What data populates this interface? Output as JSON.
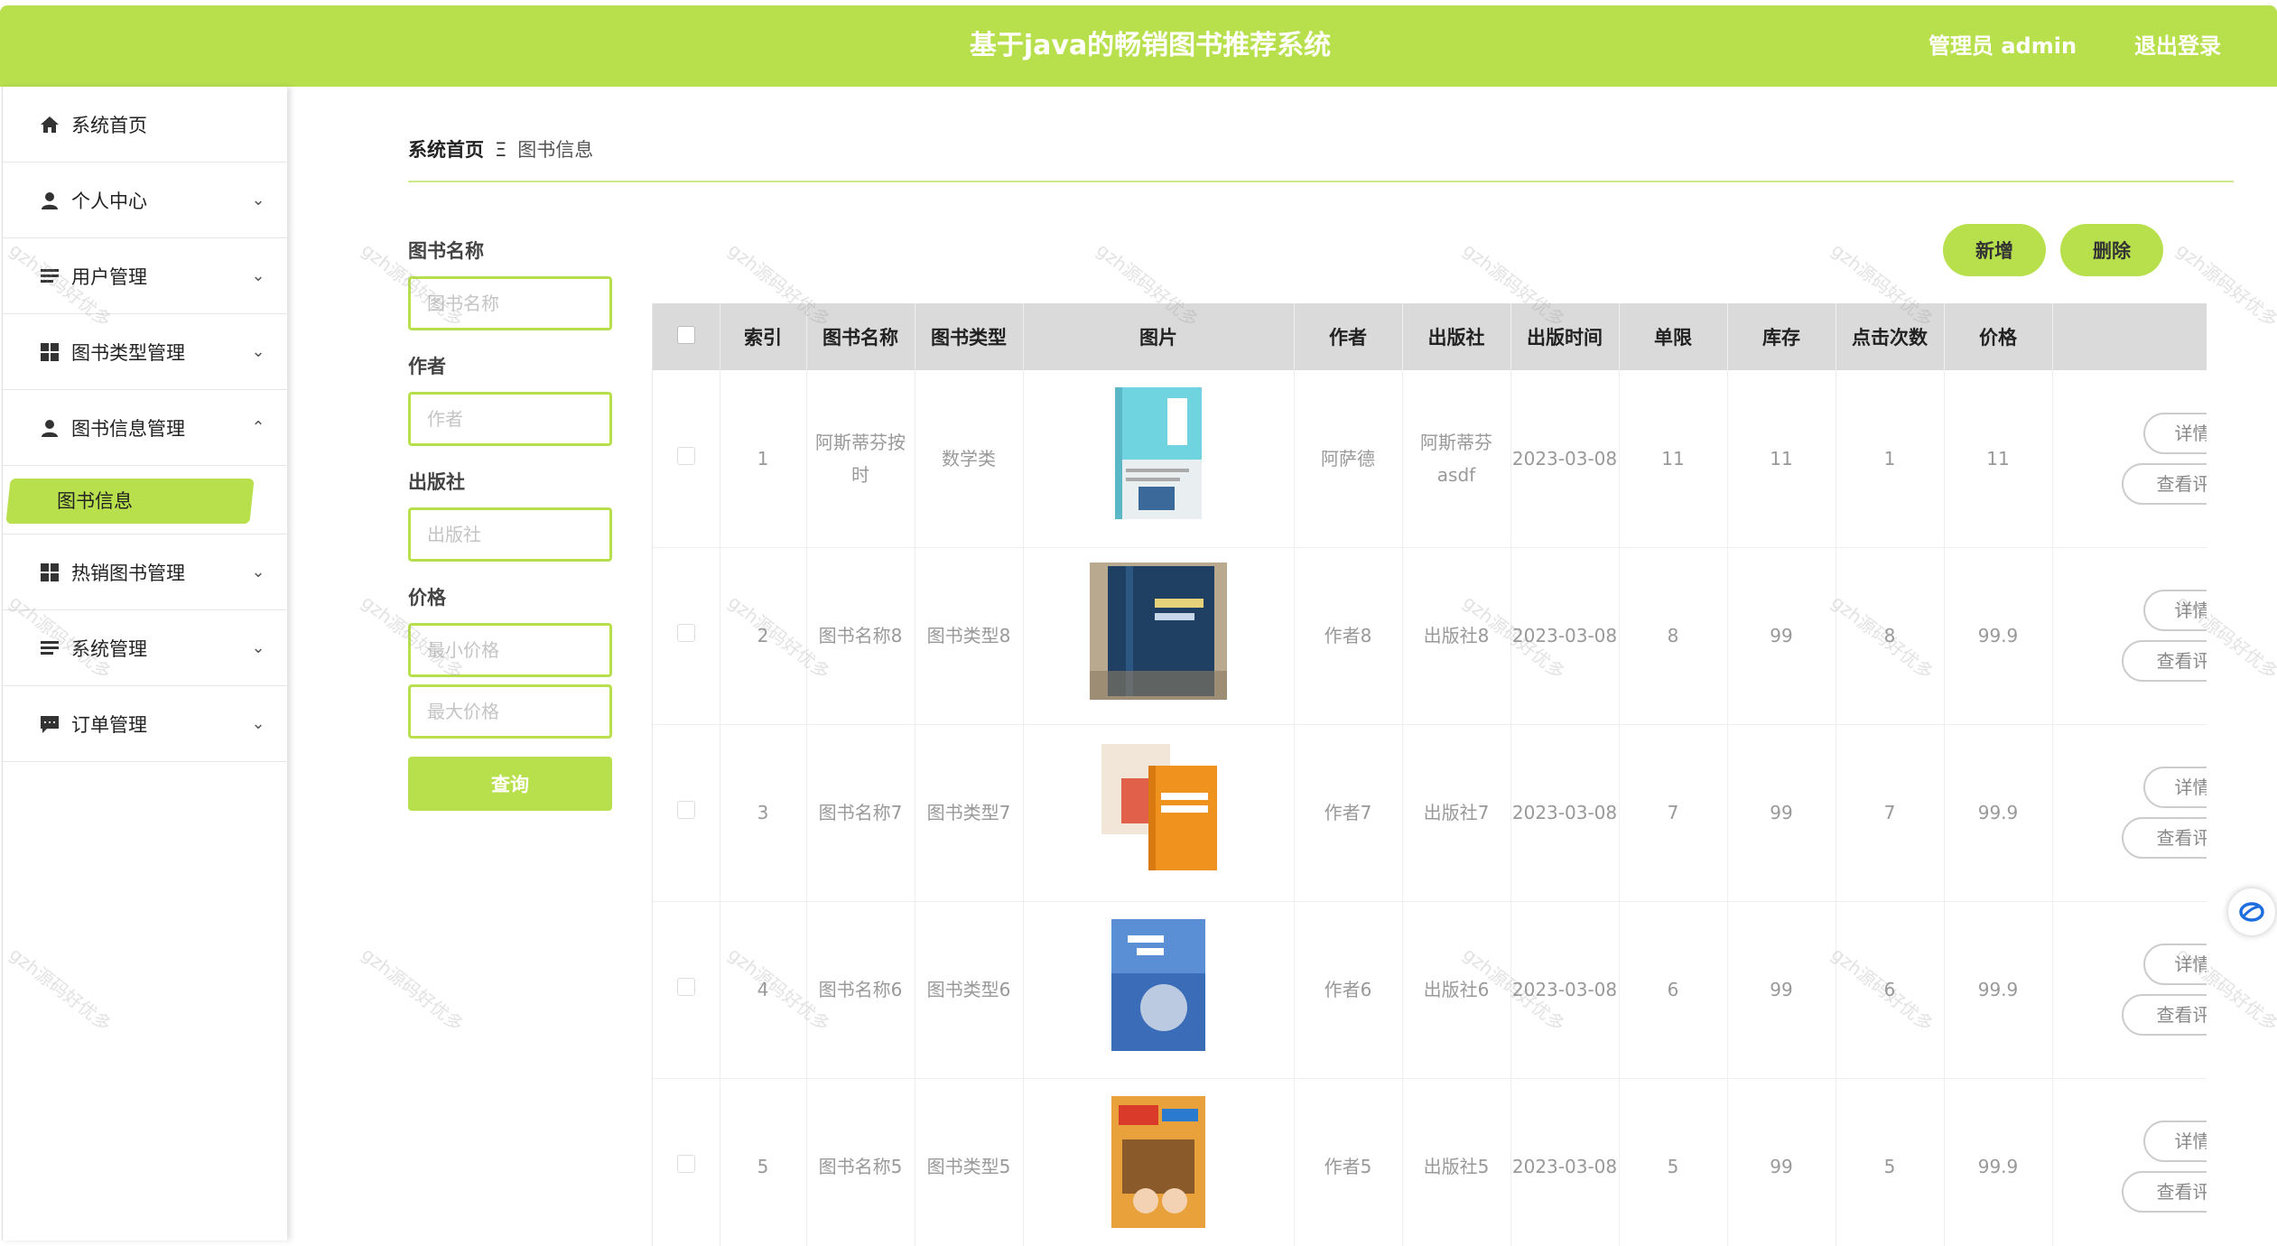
{
  "header": {
    "title": "基于java的畅销图书推荐系统",
    "admin_label": "管理员 admin",
    "logout_label": "退出登录"
  },
  "sidebar": {
    "items": [
      {
        "label": "系统首页",
        "icon": "home-icon"
      },
      {
        "label": "个人中心",
        "icon": "user-icon"
      },
      {
        "label": "用户管理",
        "icon": "list-icon"
      },
      {
        "label": "图书类型管理",
        "icon": "grid-icon"
      },
      {
        "label": "图书信息管理",
        "icon": "user-icon"
      },
      {
        "label": "图书信息",
        "icon": ""
      },
      {
        "label": "热销图书管理",
        "icon": "grid-icon"
      },
      {
        "label": "系统管理",
        "icon": "list-icon"
      },
      {
        "label": "订单管理",
        "icon": "chat-icon"
      }
    ]
  },
  "breadcrumb": {
    "home": "系统首页",
    "separator": "Ξ",
    "current": "图书信息"
  },
  "filters": {
    "name_label": "图书名称",
    "name_placeholder": "图书名称",
    "author_label": "作者",
    "author_placeholder": "作者",
    "publisher_label": "出版社",
    "publisher_placeholder": "出版社",
    "price_label": "价格",
    "min_price_placeholder": "最小价格",
    "max_price_placeholder": "最大价格",
    "search_label": "查询"
  },
  "actions": {
    "add_label": "新增",
    "delete_label": "删除"
  },
  "table": {
    "headers": [
      "索引",
      "图书名称",
      "图书类型",
      "图片",
      "作者",
      "出版社",
      "出版时间",
      "单限",
      "库存",
      "点击次数",
      "价格"
    ],
    "detail_label": "详情",
    "review_label": "查看评论",
    "rows": [
      {
        "index": "1",
        "name": "阿斯蒂芬按时",
        "type": "数学类",
        "author": "阿萨德",
        "publisher": "阿斯蒂芬asdf",
        "date": "2023-03-08",
        "limit": "11",
        "stock": "11",
        "clicks": "1",
        "price": "11",
        "cover": "book-cover-1"
      },
      {
        "index": "2",
        "name": "图书名称8",
        "type": "图书类型8",
        "author": "作者8",
        "publisher": "出版社8",
        "date": "2023-03-08",
        "limit": "8",
        "stock": "99",
        "clicks": "8",
        "price": "99.9",
        "cover": "book-cover-2"
      },
      {
        "index": "3",
        "name": "图书名称7",
        "type": "图书类型7",
        "author": "作者7",
        "publisher": "出版社7",
        "date": "2023-03-08",
        "limit": "7",
        "stock": "99",
        "clicks": "7",
        "price": "99.9",
        "cover": "book-cover-3"
      },
      {
        "index": "4",
        "name": "图书名称6",
        "type": "图书类型6",
        "author": "作者6",
        "publisher": "出版社6",
        "date": "2023-03-08",
        "limit": "6",
        "stock": "99",
        "clicks": "6",
        "price": "99.9",
        "cover": "book-cover-4"
      },
      {
        "index": "5",
        "name": "图书名称5",
        "type": "图书类型5",
        "author": "作者5",
        "publisher": "出版社5",
        "date": "2023-03-08",
        "limit": "5",
        "stock": "99",
        "clicks": "5",
        "price": "99.9",
        "cover": "book-cover-5"
      }
    ]
  },
  "watermark": "gzh源码好优多",
  "colors": {
    "accent": "#b8e04d",
    "header_text": "#ffffff"
  }
}
